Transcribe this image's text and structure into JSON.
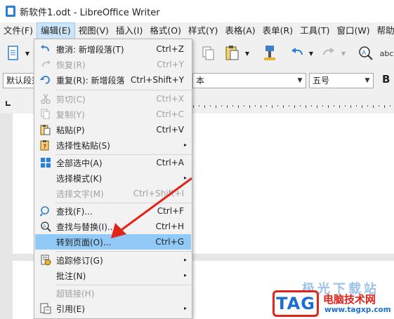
{
  "window": {
    "title": "新软件1.odt - LibreOffice Writer"
  },
  "menubar": [
    "文件(F)",
    "编辑(E)",
    "视图(V)",
    "插入(I)",
    "格式(O)",
    "样式(Y)",
    "表格(A)",
    "表单(R)",
    "工具(T)",
    "窗口(W)",
    "帮助(H)"
  ],
  "formatbar": {
    "paragraph_style": "默认段落",
    "font_name_tail": "本",
    "font_size": "五号",
    "bold": "B"
  },
  "toolbar": {
    "spell_label": "abc"
  },
  "edit_menu": {
    "items": [
      {
        "label": "撤消: 新增段落(T)",
        "shortcut": "Ctrl+Z",
        "icon": "undo-icon",
        "disabled": false
      },
      {
        "label": "恢复(R)",
        "shortcut": "Ctrl+Y",
        "icon": "redo-icon",
        "disabled": true
      },
      {
        "label": "重复(R): 新增段落",
        "shortcut": "Ctrl+Shift+Y",
        "icon": "repeat-icon",
        "disabled": false
      },
      {
        "label": "剪切(C)",
        "shortcut": "Ctrl+X",
        "icon": "scissors-icon",
        "disabled": true
      },
      {
        "label": "复制(Y)",
        "shortcut": "Ctrl+C",
        "icon": "copy-icon",
        "disabled": true
      },
      {
        "label": "粘贴(P)",
        "shortcut": "Ctrl+V",
        "icon": "paste-icon",
        "disabled": false
      },
      {
        "label": "选择性粘贴(S)",
        "shortcut": "",
        "icon": "paste-special-icon",
        "disabled": false,
        "submenu": true
      },
      {
        "label": "全部选中(A)",
        "shortcut": "Ctrl+A",
        "icon": "select-all-icon",
        "disabled": false
      },
      {
        "label": "选择模式(K)",
        "shortcut": "",
        "icon": "",
        "disabled": false,
        "submenu": true
      },
      {
        "label": "选择文字(M)",
        "shortcut": "Ctrl+Shift+I",
        "icon": "",
        "disabled": true
      },
      {
        "label": "查找(F)...",
        "shortcut": "Ctrl+F",
        "icon": "search-icon",
        "disabled": false
      },
      {
        "label": "查找与替换(I)...",
        "shortcut": "Ctrl+H",
        "icon": "find-replace-icon",
        "disabled": false
      },
      {
        "label": "转到页面(O)...",
        "shortcut": "Ctrl+G",
        "icon": "",
        "disabled": false,
        "highlighted": true
      },
      {
        "label": "追踪修订(G)",
        "shortcut": "",
        "icon": "track-changes-icon",
        "disabled": false,
        "submenu": true
      },
      {
        "label": "批注(N)",
        "shortcut": "",
        "icon": "",
        "disabled": false,
        "submenu": true
      },
      {
        "label": "超链接(H)",
        "shortcut": "",
        "icon": "",
        "disabled": true
      },
      {
        "label": "引用(E)",
        "shortcut": "",
        "icon": "reference-icon",
        "disabled": false,
        "submenu": true
      }
    ],
    "submenu_arrow": "▸"
  },
  "watermark": {
    "badge": "TAG",
    "top_text": "极光下载站",
    "cn_text": "电脑技术网",
    "url": "www.tagxp.com"
  },
  "colors": {
    "highlight": "#91c9f7",
    "menubar_active": "#cce4f7",
    "arrow": "#e2231a",
    "app_blue": "#2b7fd4"
  }
}
